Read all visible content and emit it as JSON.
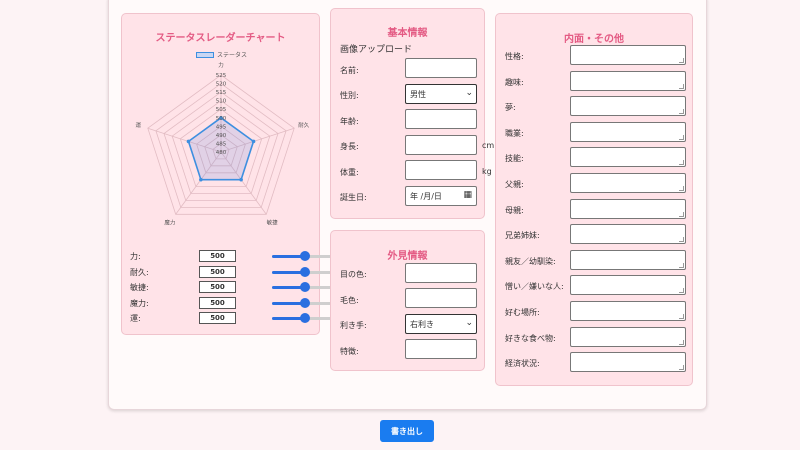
{
  "radar": {
    "title": "ステータスレーダーチャート",
    "legend": "ステータス",
    "ticks": [
      "525",
      "520",
      "515",
      "510",
      "505",
      "500",
      "495",
      "490",
      "485",
      "480"
    ],
    "axes": [
      "力",
      "耐久",
      "敏捷",
      "魔力",
      "運"
    ],
    "stats": [
      {
        "label": "力:",
        "value": "500",
        "fill": 0.5
      },
      {
        "label": "耐久:",
        "value": "500",
        "fill": 0.5
      },
      {
        "label": "敏捷:",
        "value": "500",
        "fill": 0.5
      },
      {
        "label": "魔力:",
        "value": "500",
        "fill": 0.5
      },
      {
        "label": "運:",
        "value": "500",
        "fill": 0.5
      }
    ]
  },
  "chart_data": {
    "type": "radar",
    "title": "ステータスレーダーチャート",
    "categories": [
      "力",
      "耐久",
      "敏捷",
      "魔力",
      "運"
    ],
    "series": [
      {
        "name": "ステータス",
        "values": [
          500,
          500,
          500,
          500,
          500
        ]
      }
    ],
    "ylim": [
      480,
      525
    ],
    "ticks": [
      480,
      485,
      490,
      495,
      500,
      505,
      510,
      515,
      520,
      525
    ]
  },
  "basic": {
    "title": "基本情報",
    "image_upload": "画像アップロード",
    "name_label": "名前:",
    "gender_label": "性別:",
    "gender_value": "男性",
    "age_label": "年齢:",
    "height_label": "身長:",
    "height_unit": "cm",
    "weight_label": "体重:",
    "weight_unit": "kg",
    "birthday_label": "誕生日:",
    "birthday_placeholder": "年 /月/日"
  },
  "appearance": {
    "title": "外見情報",
    "eye_label": "目の色:",
    "hair_label": "毛色:",
    "hand_label": "利き手:",
    "hand_value": "右利き",
    "features_label": "特徴:"
  },
  "inner": {
    "title": "内面・その他",
    "fields": [
      "性格:",
      "趣味:",
      "夢:",
      "職業:",
      "技能:",
      "父親:",
      "母親:",
      "兄弟姉妹:",
      "親友／幼馴染:",
      "憎い／嫌いな人:",
      "好む場所:",
      "好きな食べ物:",
      "経済状況:"
    ]
  },
  "export_button": "書き出し",
  "colors": {
    "accent": "#e45b84",
    "panel": "#ffe3e8",
    "button": "#1a7cf0",
    "radar_line": "#3d8fe0"
  }
}
